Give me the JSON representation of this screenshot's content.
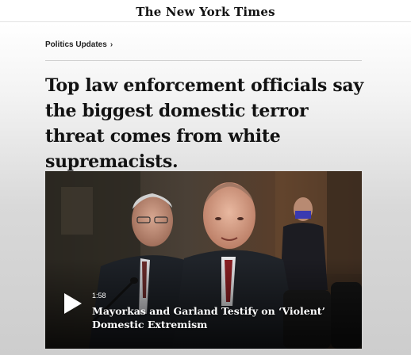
{
  "header": {
    "masthead": "The New York Times"
  },
  "kicker": {
    "label": "Politics Updates",
    "chevron": "›"
  },
  "article": {
    "headline": "Top law enforcement officials say the biggest domestic terror threat comes from white supremacists."
  },
  "video": {
    "duration": "1:58",
    "title": "Mayorkas and Garland Testify on ‘Violent’ Domestic Extremism",
    "play_icon": "play-icon"
  }
}
